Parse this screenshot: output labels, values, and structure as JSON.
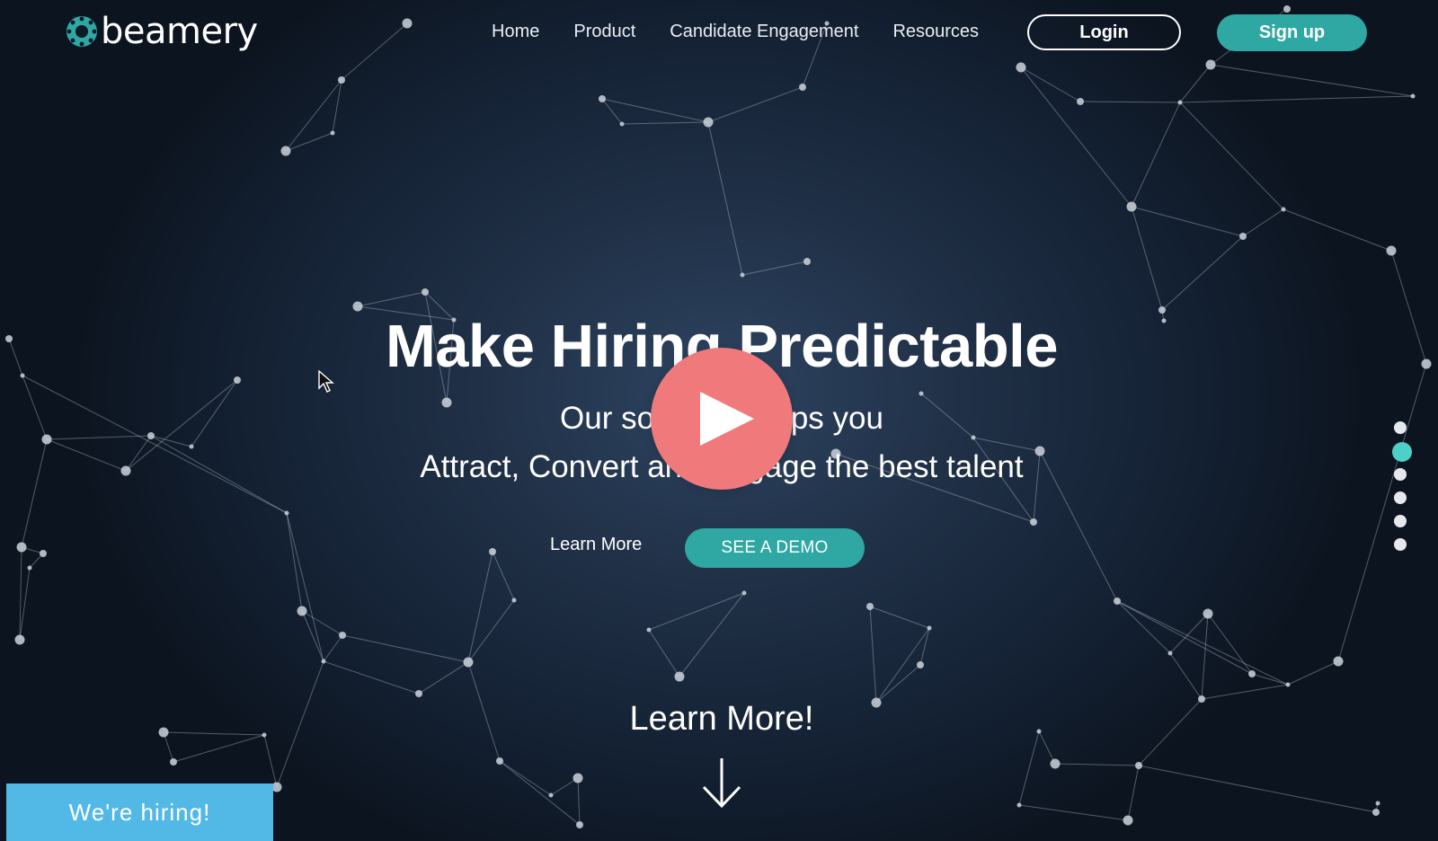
{
  "brand": {
    "name": "beamery",
    "accent": "#2fa7a3"
  },
  "nav": {
    "items": [
      {
        "label": "Home"
      },
      {
        "label": "Product"
      },
      {
        "label": "Candidate Engagement"
      },
      {
        "label": "Resources"
      }
    ],
    "login_label": "Login",
    "signup_label": "Sign up"
  },
  "hero": {
    "title": "Make Hiring Predictable",
    "subtitle_line1": "Our software helps you",
    "subtitle_line2": "Attract, Convert and Engage the best talent",
    "learn_more_label": "Learn More",
    "demo_label": "SEE A DEMO",
    "play_icon": "play-icon",
    "play_color": "#f07a7b"
  },
  "scroll": {
    "label": "Learn More!",
    "icon": "arrow-down-icon"
  },
  "section_nav": {
    "count": 6,
    "active_index": 1,
    "active_color": "#4ecfc7"
  },
  "hiring_tab": {
    "label": "We're hiring!",
    "color": "#52b8e6"
  }
}
